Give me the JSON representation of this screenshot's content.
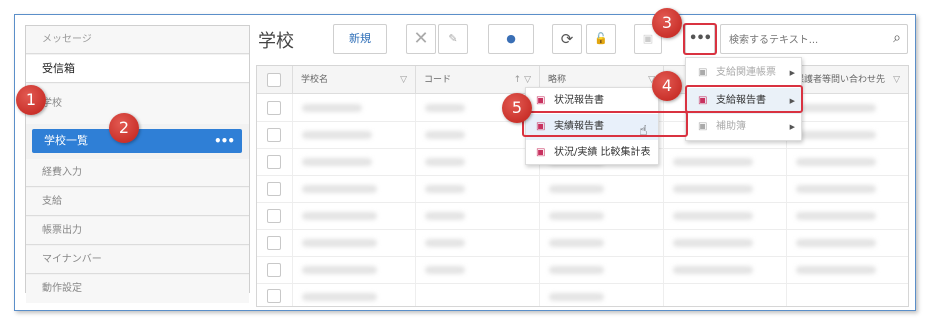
{
  "sidebar": {
    "items": [
      {
        "label": "メッセージ"
      },
      {
        "label": "受信箱"
      },
      {
        "label": "学校"
      },
      {
        "label": "学校一覧",
        "more": "•••"
      },
      {
        "label": "経費入力"
      },
      {
        "label": "支給"
      },
      {
        "label": "帳票出力"
      },
      {
        "label": "マイナンバー"
      },
      {
        "label": "動作設定"
      }
    ]
  },
  "toolbar": {
    "title": "学校",
    "new_label": "新規",
    "more_label": "•••",
    "search_placeholder": "検索するテキスト..."
  },
  "table": {
    "headers": [
      "学校名",
      "コード",
      "略称",
      "",
      "保護者等問い合わせ先"
    ]
  },
  "submenu": {
    "items": [
      {
        "label": "支給関連帳票"
      },
      {
        "label": "支給報告書"
      },
      {
        "label": "補助簿"
      }
    ]
  },
  "report_menu": {
    "items": [
      {
        "label": "状況報告書"
      },
      {
        "label": "実績報告書"
      },
      {
        "label": "状況/実績 比較集計表"
      }
    ]
  },
  "badges": [
    "1",
    "2",
    "3",
    "4",
    "5"
  ],
  "colors": {
    "accent": "#2f7fd6",
    "highlight": "#d93240",
    "badge": "#c0201a"
  }
}
